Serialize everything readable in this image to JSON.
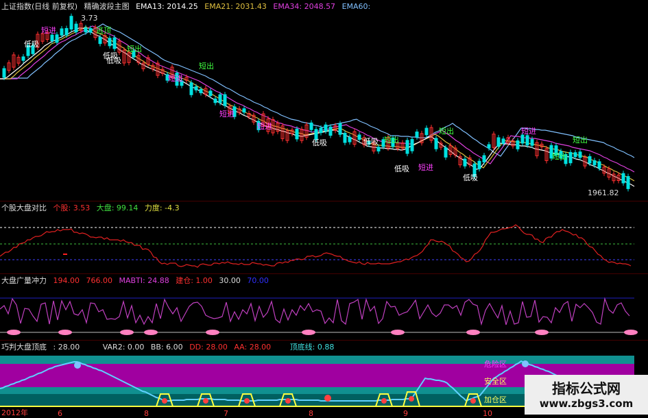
{
  "main": {
    "title": "上证指数(日线 前复权)",
    "indicator": "精确波段主图",
    "ema13_label": "EMA13: 2014.25",
    "ema21_label": "EMA21: 2031.43",
    "ema34_label": "EMA34: 2048.57",
    "ema60_label": "EMA60:",
    "high_label": "3.73",
    "low_label": "1961.82",
    "signals": [
      "低吸",
      "短进",
      "逃顶",
      "短出",
      "低吸",
      "短进",
      "短出",
      "低吸",
      "短进",
      "短进",
      "低吸",
      "低吸",
      "短出",
      "低吸",
      "短出",
      "短进",
      "低吸",
      "短进",
      "短出",
      "短出"
    ]
  },
  "panel2": {
    "title": "个股大盘对比",
    "stock_label": "个股: 3.53",
    "market_label": "大盘: 99.14",
    "force_label": "力度: -4.3"
  },
  "panel3": {
    "title": "大盘广量冲力",
    "v1": "194.00",
    "v2": "766.00",
    "mabti_label": "MABTI: 24.88",
    "build_label": "建仓: 1.00",
    "v3": "30.00",
    "v4": "70.00"
  },
  "panel4": {
    "title": "巧判大盘顶底",
    "v1": ": 28.00",
    "var2_label": "VAR2: 0.00",
    "bb_label": "BB: 6.00",
    "dd_label": "DD: 28.00",
    "aa_label": "AA: 28.00",
    "dingdi_label": "顶底线: 0.88",
    "zone_danger": "危险区",
    "zone_safe": "安全区",
    "zone_add": "加仓区"
  },
  "xaxis": [
    "2012年",
    "6",
    "8",
    "7",
    "8",
    "9",
    "10"
  ],
  "watermark": {
    "line1": "指标公式网",
    "line2": "www.zbgs3.com"
  },
  "colors": {
    "ema13": "#ffffff",
    "ema21": "#e0c040",
    "ema34": "#e040e0",
    "ema60": "#80c0ff",
    "up": "#ff3030",
    "down": "#00e0e0",
    "teal": "#109090",
    "purple": "#a000a0"
  }
}
